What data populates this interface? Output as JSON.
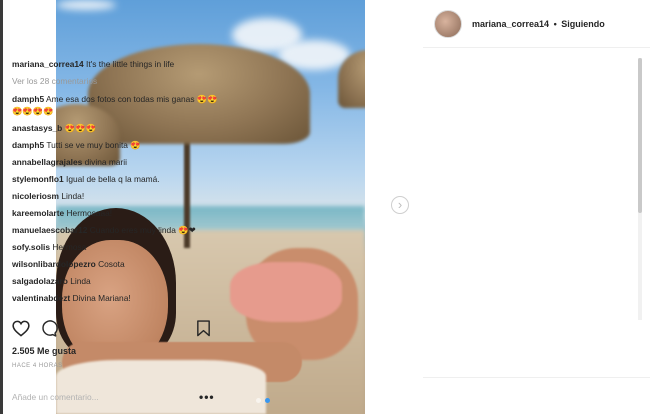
{
  "post": {
    "username": "mariana_correa14",
    "separator": "•",
    "follow_status": "Siguiendo",
    "icons": {
      "avatar": "profile-avatar",
      "next": "chevron-right-icon",
      "like": "heart-outline-icon",
      "comment": "speech-bubble-icon",
      "save": "bookmark-icon",
      "more": "ellipsis-icon"
    },
    "carousel": {
      "slides": 2,
      "active_slide": 2
    },
    "view_all_comments": "Ver los 28 comentarios",
    "caption": {
      "user": "mariana_correa14",
      "text": "It's the little things in life"
    },
    "comments": [
      {
        "user": "damph5",
        "text": "Ame esa dos fotos con todas mis ganas 😍😍😍😍😍😍"
      },
      {
        "user": "anastasys_b",
        "text": "😍😍😍"
      },
      {
        "user": "damph5",
        "text": "Tutti se ve muy bonita 😍"
      },
      {
        "user": "annabellagrajales",
        "text": "divina marii"
      },
      {
        "user": "stylemonflo1",
        "text": "Igual de bella q la mamá."
      },
      {
        "user": "nicoleriosm",
        "text": "Linda!"
      },
      {
        "user": "kareemolarte",
        "text": "Hermosaaa!"
      },
      {
        "user": "manuelaescobar12",
        "text": "Cuando eres muy linda 😍❤"
      },
      {
        "user": "sofy.solis",
        "text": "Hermosa"
      },
      {
        "user": "wilsonlibardolopezro",
        "text": "Cosota"
      },
      {
        "user": "salgadolazaro",
        "text": "Linda"
      },
      {
        "user": "valentinabdezt",
        "text": "Divina Mariana!"
      }
    ],
    "likes": "2.505 Me gusta",
    "timestamp": "HACE 4 HORAS",
    "add_comment_placeholder": "Añade un comentario...",
    "more_label": "•••"
  }
}
